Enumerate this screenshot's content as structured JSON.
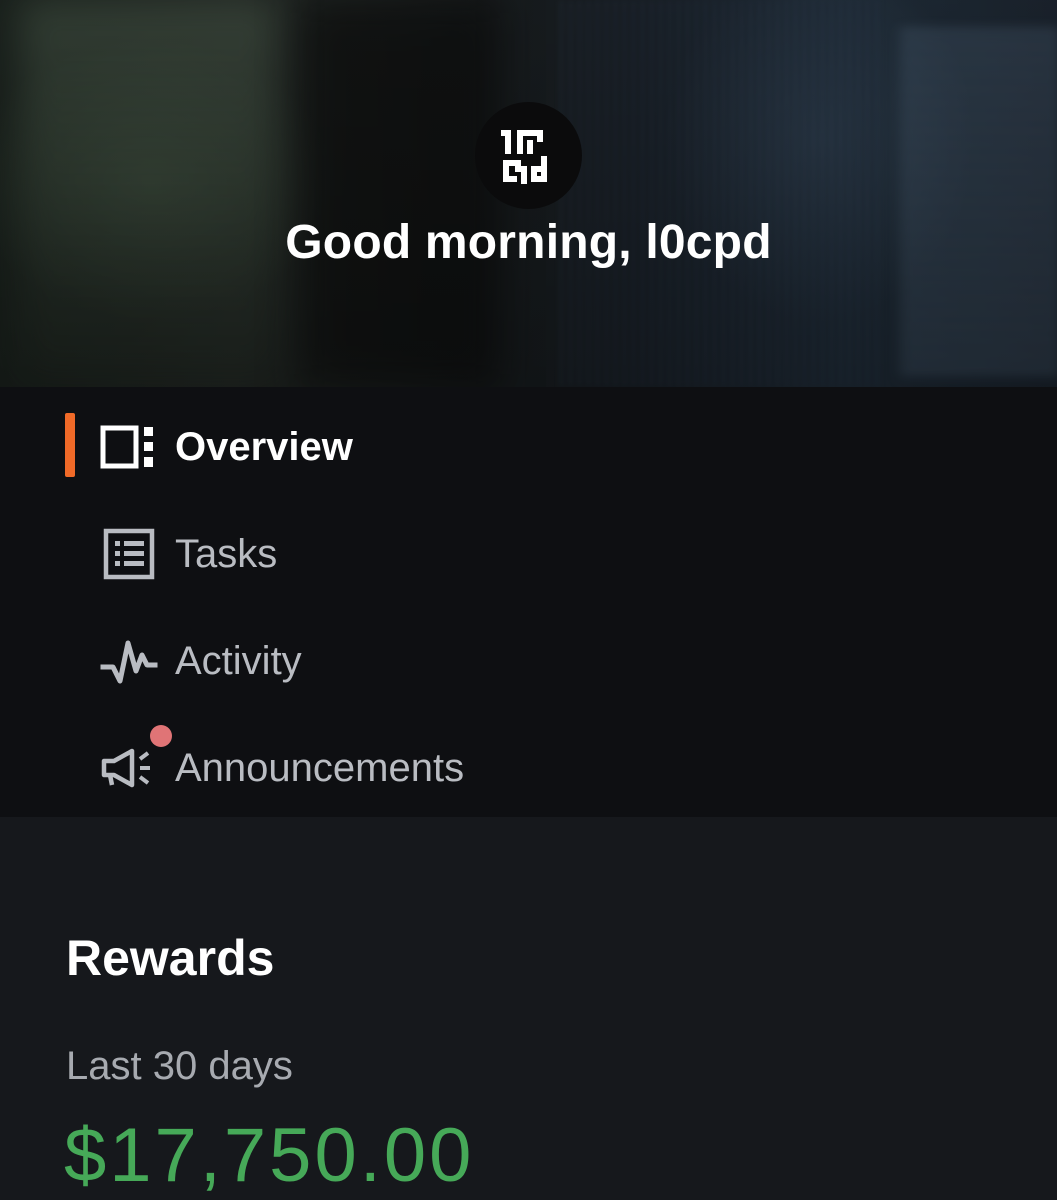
{
  "header": {
    "greeting": "Good morning, l0cpd",
    "avatar_icon": "logo-icon",
    "avatar_text_top": "10",
    "avatar_text_bottom": "cpd"
  },
  "nav": {
    "items": [
      {
        "label": "Overview",
        "icon": "overview-icon",
        "active": true
      },
      {
        "label": "Tasks",
        "icon": "list-icon",
        "active": false
      },
      {
        "label": "Activity",
        "icon": "activity-icon",
        "active": false
      },
      {
        "label": "Announcements",
        "icon": "megaphone-icon",
        "active": false,
        "has_notification": true
      }
    ],
    "accent_color": "#f06a28",
    "notification_color": "#e07476"
  },
  "rewards": {
    "title": "Rewards",
    "period": "Last 30 days",
    "amount": "$17,750.00",
    "amount_color": "#46a958"
  }
}
